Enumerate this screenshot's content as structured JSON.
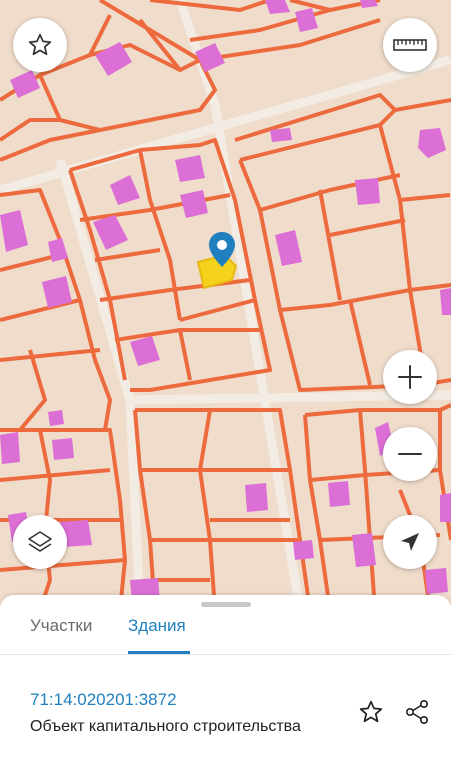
{
  "tabs": {
    "parcels": "Участки",
    "buildings": "Здания",
    "active": "buildings"
  },
  "selection": {
    "cadastral_number": "71:14:020201:3872",
    "object_type": "Объект капитального строительства"
  },
  "icons": {
    "favorites": "star-icon",
    "ruler": "ruler-icon",
    "zoom_in": "plus-icon",
    "zoom_out": "minus-icon",
    "layers": "layers-icon",
    "locate": "navigation-arrow-icon",
    "marker": "location-pin-icon",
    "fav_object": "star-outline-icon",
    "share": "share-icon"
  },
  "colors": {
    "map_background": "#f0dccb",
    "parcel_border": "#ec6a3d",
    "building_fill": "#dc6fd6",
    "selected_building": "#f5d21c",
    "marker": "#1f7fbf",
    "accent": "#1f7fbf"
  }
}
